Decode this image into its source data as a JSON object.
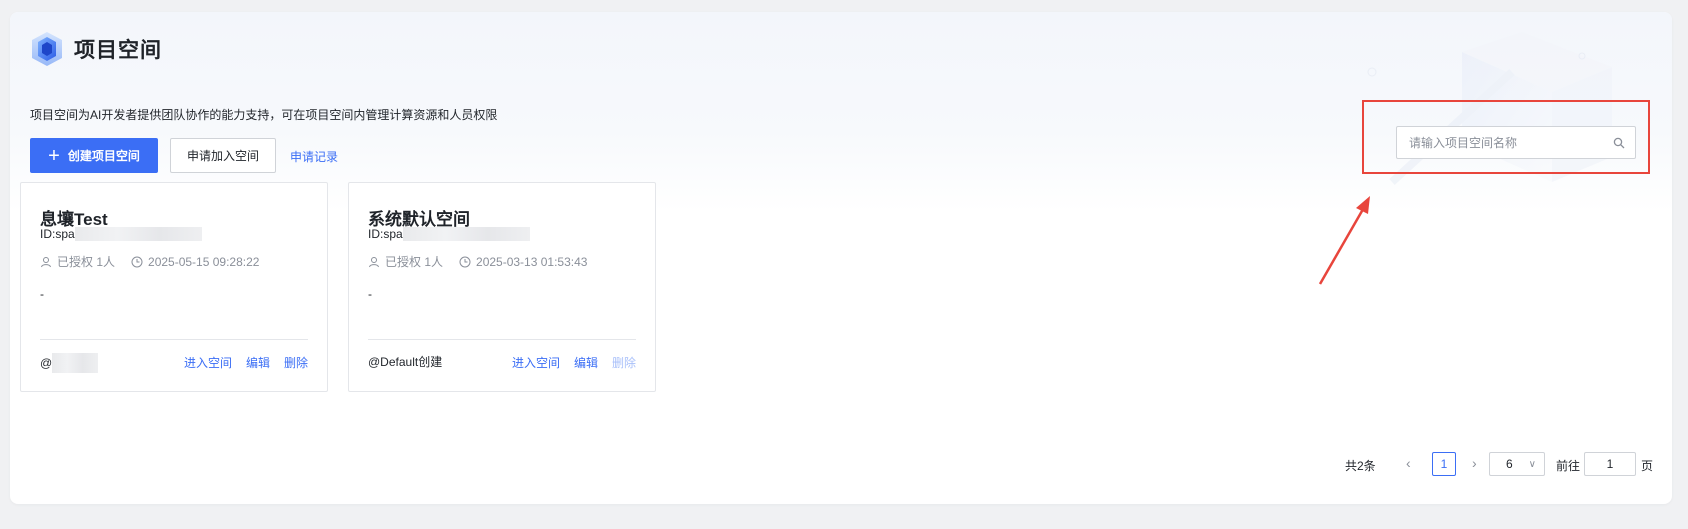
{
  "page": {
    "title": "项目空间",
    "description": "项目空间为AI开发者提供团队协作的能力支持，可在项目空间内管理计算资源和人员权限"
  },
  "toolbar": {
    "create_label": "创建项目空间",
    "join_label": "申请加入空间",
    "records_label": "申请记录"
  },
  "search": {
    "placeholder": "请输入项目空间名称",
    "value": ""
  },
  "cards": [
    {
      "name": "息壤Test",
      "id_prefix": "ID:spa",
      "authorized": "已授权 1人",
      "created_time": "2025-05-15 09:28:22",
      "description": "-",
      "creator_prefix": "@",
      "creator_visible": "",
      "actions": {
        "enter": "进入空间",
        "edit": "编辑",
        "delete": "删除"
      },
      "delete_disabled": false
    },
    {
      "name": "系统默认空间",
      "id_prefix": "ID:spa",
      "authorized": "已授权 1人",
      "created_time": "2025-03-13 01:53:43",
      "description": "-",
      "creator_prefix": "@Default创建",
      "creator_visible": "",
      "actions": {
        "enter": "进入空间",
        "edit": "编辑",
        "delete": "删除"
      },
      "delete_disabled": true
    }
  ],
  "pagination": {
    "total_label": "共2条",
    "current_page": "1",
    "page_size": "6",
    "goto_label": "前往",
    "goto_value": "1",
    "goto_suffix": "页"
  },
  "colors": {
    "primary": "#3b6ef5",
    "highlight": "#e8453c",
    "disabled_link": "#a9c0fa"
  },
  "icons": {
    "logo": "cube-logo-icon",
    "search": "search-icon",
    "user": "user-icon",
    "clock": "clock-icon",
    "plus": "plus-icon",
    "prev": "chevron-left-icon",
    "next": "chevron-right-icon",
    "dropdown": "chevron-down-icon"
  }
}
